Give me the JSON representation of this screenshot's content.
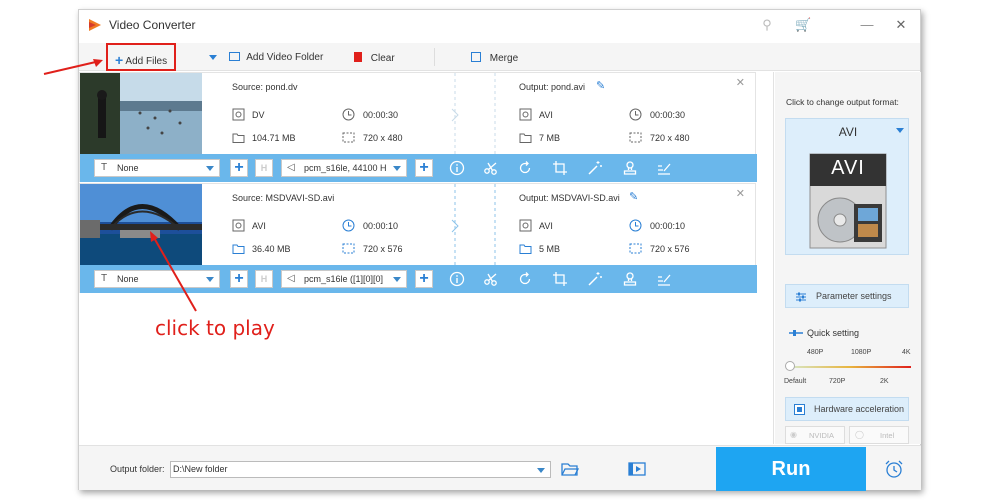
{
  "window": {
    "title": "Video Converter"
  },
  "toolbar": {
    "add_files": "Add Files",
    "add_video_folder": "Add Video Folder",
    "clear": "Clear",
    "merge": "Merge"
  },
  "files": [
    {
      "source_name": "Source: pond.dv",
      "src_format": "DV",
      "src_duration": "00:00:30",
      "src_size": "104.71 MB",
      "src_res": "720 x 480",
      "output_name": "Output: pond.avi",
      "out_format": "AVI",
      "out_duration": "00:00:30",
      "out_size": "7 MB",
      "out_res": "720 x 480",
      "subtitle": "None",
      "audio": "pcm_s16le, 44100 H"
    },
    {
      "source_name": "Source: MSDVAVI-SD.avi",
      "src_format": "AVI",
      "src_duration": "00:00:10",
      "src_size": "36.40 MB",
      "src_res": "720 x 576",
      "output_name": "Output: MSDVAVI-SD.avi",
      "out_format": "AVI",
      "out_duration": "00:00:10",
      "out_size": "5 MB",
      "out_res": "720 x 576",
      "subtitle": "None",
      "audio": "pcm_s16le ([1][0][0]"
    }
  ],
  "right_panel": {
    "hint": "Click to change output format:",
    "format": "AVI",
    "format_icon_text": "AVI",
    "param_settings": "Parameter settings",
    "quick_setting": "Quick setting",
    "quality_top": [
      "480P",
      "1080P",
      "4K"
    ],
    "quality_bottom": [
      "Default",
      "720P",
      "2K"
    ],
    "hw_accel": "Hardware acceleration",
    "nvidia": "NVIDIA",
    "intel": "Intel"
  },
  "bottom": {
    "output_folder_label": "Output folder:",
    "output_folder_value": "D:\\New folder",
    "run": "Run"
  },
  "annotation": {
    "text": "click to play"
  },
  "colors": {
    "accent": "#1ea5f2",
    "bar": "#6ab7eb",
    "annotation": "#e0201b"
  }
}
